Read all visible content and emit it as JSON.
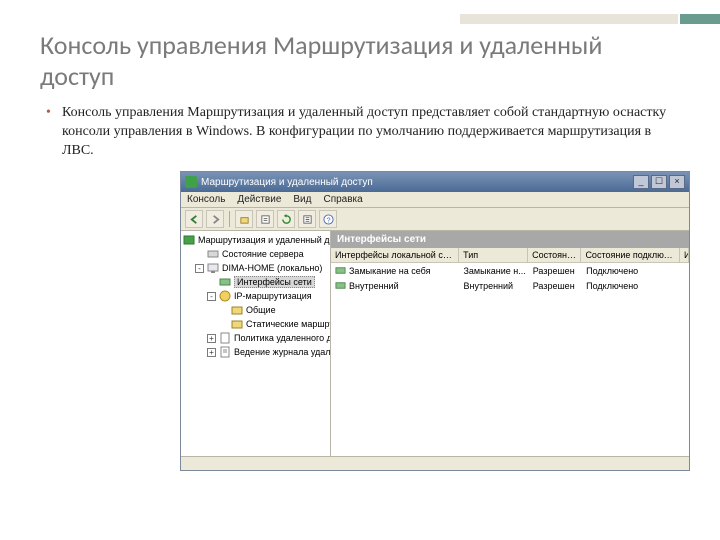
{
  "slide": {
    "title": "Консоль управления Маршрутизация и удаленный доступ",
    "bullet": "Консоль управления Маршрутизация и удаленный доступ представляет собой стандартную оснастку консоли управления в Windows. В конфигурации по умолчанию поддерживается маршрутизация в ЛВС."
  },
  "window": {
    "title": "Маршрутизация и удаленный доступ",
    "menus": [
      "Консоль",
      "Действие",
      "Вид",
      "Справка"
    ],
    "win_buttons": {
      "min": "_",
      "max": "☐",
      "close": "×"
    }
  },
  "tree": {
    "root": "Маршрутизация и удаленный до",
    "items": [
      {
        "label": "Состояние сервера",
        "indent": 1
      },
      {
        "label": "DIMA-HOME (локально)",
        "indent": 1,
        "exp": "-"
      },
      {
        "label": "Интерфейсы сети",
        "indent": 2,
        "selected": true
      },
      {
        "label": "IP-маршрутизация",
        "indent": 2,
        "exp": "-"
      },
      {
        "label": "Общие",
        "indent": 3
      },
      {
        "label": "Статические маршру",
        "indent": 3
      },
      {
        "label": "Политика удаленного до",
        "indent": 2,
        "exp": "+"
      },
      {
        "label": "Ведение журнала удален",
        "indent": 2,
        "exp": "+"
      }
    ]
  },
  "details": {
    "header": "Интерфейсы сети",
    "columns": [
      "Интерфейсы локальной сети и ...",
      "Тип",
      "Состояние",
      "Состояние подключения",
      "Имя устройства"
    ],
    "rows": [
      {
        "name": "Замыкание на себя",
        "type": "Замыкание н...",
        "state": "Разрешен",
        "conn": "Подключено",
        "dev": ""
      },
      {
        "name": "Внутренний",
        "type": "Внутренний",
        "state": "Разрешен",
        "conn": "Подключено",
        "dev": ""
      }
    ]
  }
}
